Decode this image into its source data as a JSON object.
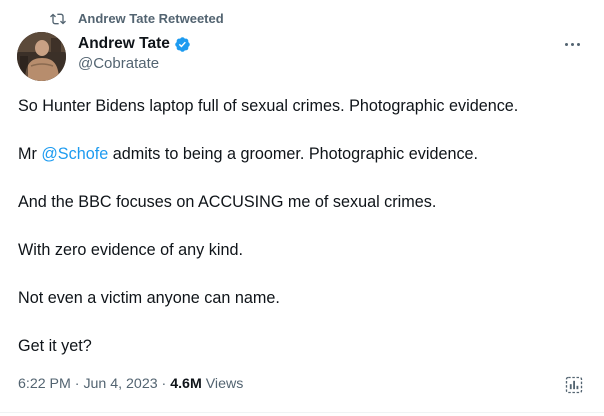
{
  "retweet": {
    "label": "Andrew Tate Retweeted",
    "icon": "retweet-icon"
  },
  "author": {
    "name": "Andrew Tate",
    "handle": "@Cobratate",
    "verified": true,
    "verified_color": "#1d9bf0",
    "avatar_icon": "avatar-photo"
  },
  "more_icon": "more-options-icon",
  "tweet": {
    "lines": [
      {
        "text": "So Hunter Bidens laptop full of sexual crimes. Photographic evidence."
      },
      {
        "before": "Mr ",
        "mention": "@Schofe",
        "after": " admits to being a groomer. Photographic evidence."
      },
      {
        "text": "And the BBC focuses on ACCUSING me of sexual crimes."
      },
      {
        "text": "With zero evidence of any kind."
      },
      {
        "text": "Not even a victim anyone can name."
      },
      {
        "text": "Get it yet?"
      }
    ]
  },
  "meta": {
    "time": "6:22 PM",
    "separator": " · ",
    "date": "Jun 4, 2023",
    "views_count": "4.6M",
    "views_label": " Views",
    "analytics_icon": "analytics-icon"
  },
  "colors": {
    "text": "#0f1419",
    "secondary": "#536471",
    "link": "#1d9bf0"
  }
}
